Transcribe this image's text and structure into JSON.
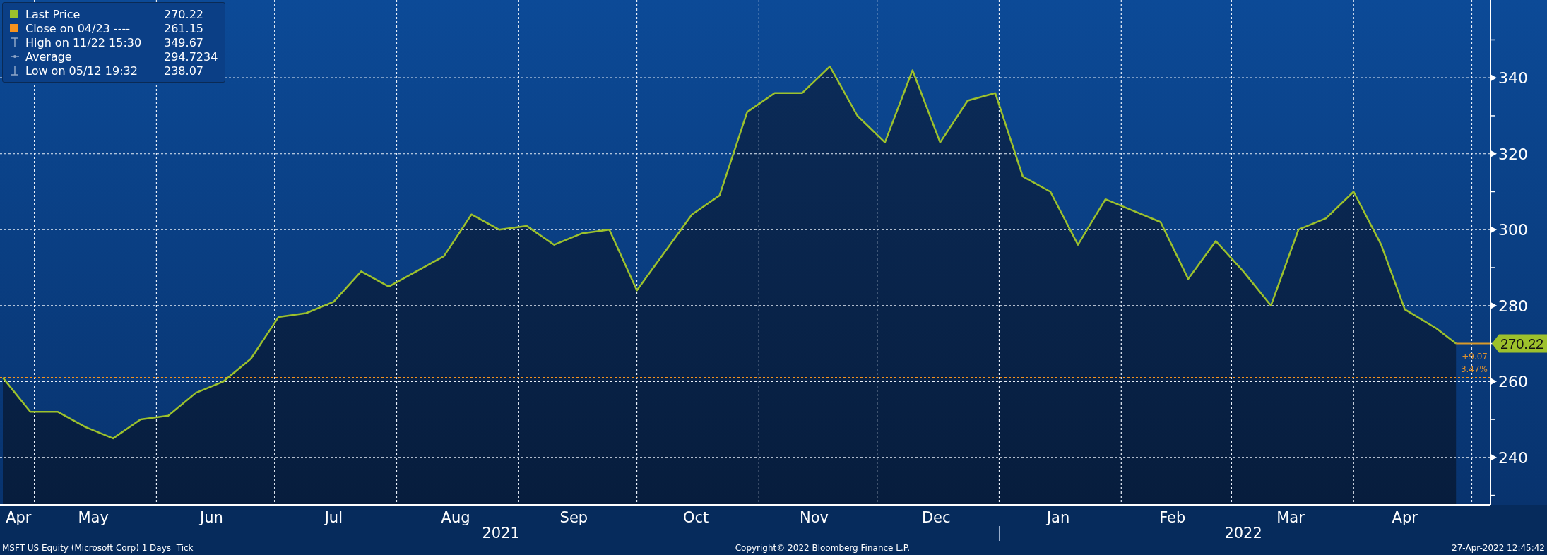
{
  "legend": [
    {
      "kind": "series",
      "value": "270.22"
    },
    {
      "kind": "swatch",
      "label": "Close on 04/23 ----",
      "value": "261.15",
      "color": "#f7931e"
    },
    {
      "kind": "high",
      "label": "High on 11/22 15:30",
      "value": "349.67"
    },
    {
      "kind": "average",
      "label": "Average",
      "value": "294.7234"
    },
    {
      "kind": "low",
      "label": "Low on 05/12 19:32",
      "value": "238.07"
    }
  ],
  "chart_data": {
    "type": "area",
    "grid": true,
    "xlim": [
      "2021-04-23",
      "2022-05-05"
    ],
    "x": [
      "2021-04-23",
      "2021-04-30",
      "2021-05-07",
      "2021-05-14",
      "2021-05-21",
      "2021-05-28",
      "2021-06-04",
      "2021-06-11",
      "2021-06-18",
      "2021-06-25",
      "2021-07-02",
      "2021-07-09",
      "2021-07-16",
      "2021-07-23",
      "2021-07-30",
      "2021-08-06",
      "2021-08-13",
      "2021-08-20",
      "2021-08-27",
      "2021-09-03",
      "2021-09-10",
      "2021-09-17",
      "2021-09-24",
      "2021-10-01",
      "2021-10-08",
      "2021-10-15",
      "2021-10-22",
      "2021-10-29",
      "2021-11-05",
      "2021-11-12",
      "2021-11-19",
      "2021-11-26",
      "2021-12-03",
      "2021-12-10",
      "2021-12-17",
      "2021-12-24",
      "2021-12-31",
      "2022-01-07",
      "2022-01-14",
      "2022-01-21",
      "2022-01-28",
      "2022-02-04",
      "2022-02-11",
      "2022-02-18",
      "2022-02-25",
      "2022-03-04",
      "2022-03-11",
      "2022-03-18",
      "2022-03-25",
      "2022-04-01",
      "2022-04-08",
      "2022-04-14",
      "2022-04-22",
      "2022-04-27"
    ],
    "series": [
      {
        "name": "Last Price",
        "color": "#9dc12c",
        "values": [
          261,
          252,
          252,
          248,
          245,
          250,
          251,
          257,
          260,
          266,
          277,
          278,
          281,
          289,
          285,
          289,
          293,
          304,
          300,
          301,
          296,
          299,
          300,
          284,
          294,
          304,
          309,
          331,
          336,
          336,
          343,
          330,
          323,
          342,
          323,
          334,
          336,
          314,
          310,
          296,
          308,
          305,
          302,
          287,
          297,
          289,
          280,
          300,
          303,
          310,
          296,
          279,
          274,
          270
        ]
      }
    ],
    "ylim": [
      227.5,
      360.5
    ],
    "yticks": [
      240,
      260,
      280,
      300,
      320,
      340
    ],
    "xticks": [
      {
        "value": "2021-04-27",
        "label": "Apr"
      },
      {
        "value": "2021-05-16",
        "label": "May"
      },
      {
        "value": "2021-06-15",
        "label": "Jun"
      },
      {
        "value": "2021-07-16",
        "label": "Jul"
      },
      {
        "value": "2021-08-16",
        "label": "Aug"
      },
      {
        "value": "2021-09-15",
        "label": "Sep"
      },
      {
        "value": "2021-10-16",
        "label": "Oct"
      },
      {
        "value": "2021-11-15",
        "label": "Nov"
      },
      {
        "value": "2021-12-16",
        "label": "Dec"
      },
      {
        "value": "2022-01-16",
        "label": "Jan"
      },
      {
        "value": "2022-02-14",
        "label": "Feb"
      },
      {
        "value": "2022-03-16",
        "label": "Mar"
      },
      {
        "value": "2022-04-14",
        "label": "Apr"
      }
    ],
    "ref_lines": [
      {
        "value": 261,
        "axis": "y"
      }
    ]
  },
  "x_axis_years": [
    {
      "label": "2021"
    },
    {
      "label": "2022"
    }
  ],
  "price_tag": {
    "value": "270.22",
    "change": "+9.07",
    "percent": "3.47%"
  },
  "footer": {
    "left": "MSFT US Equity (Microsoft Corp) 1 Days  Tick",
    "center": "Copyright© 2022 Bloomberg Finance L.P.",
    "right": "27-Apr-2022 12:45:42"
  }
}
